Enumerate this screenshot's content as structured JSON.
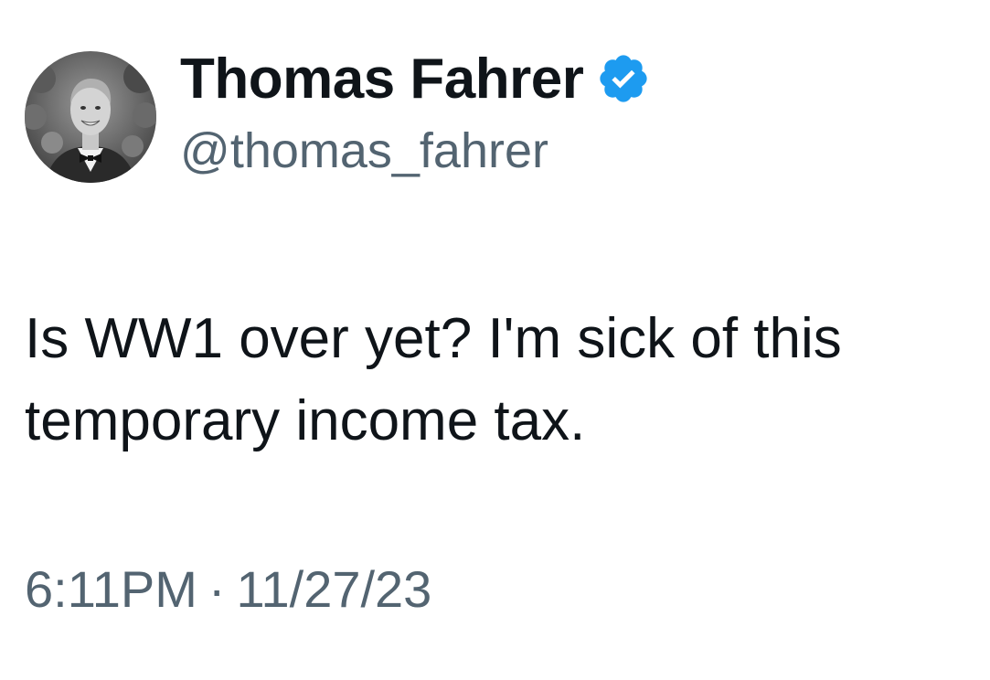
{
  "tweet": {
    "author": {
      "display_name": "Thomas Fahrer",
      "handle": "@thomas_fahrer",
      "verified_icon": "verified-badge-icon",
      "avatar_icon": "avatar-photo"
    },
    "text_lines": [
      "Is WW1 over yet? I'm sick of this",
      "temporary income tax."
    ],
    "time": "6:11PM",
    "separator": "·",
    "date": "11/27/23"
  },
  "colors": {
    "primary_text": "#0f1419",
    "secondary_text": "#536471",
    "verified_blue": "#1d9bf0",
    "background": "#ffffff"
  }
}
